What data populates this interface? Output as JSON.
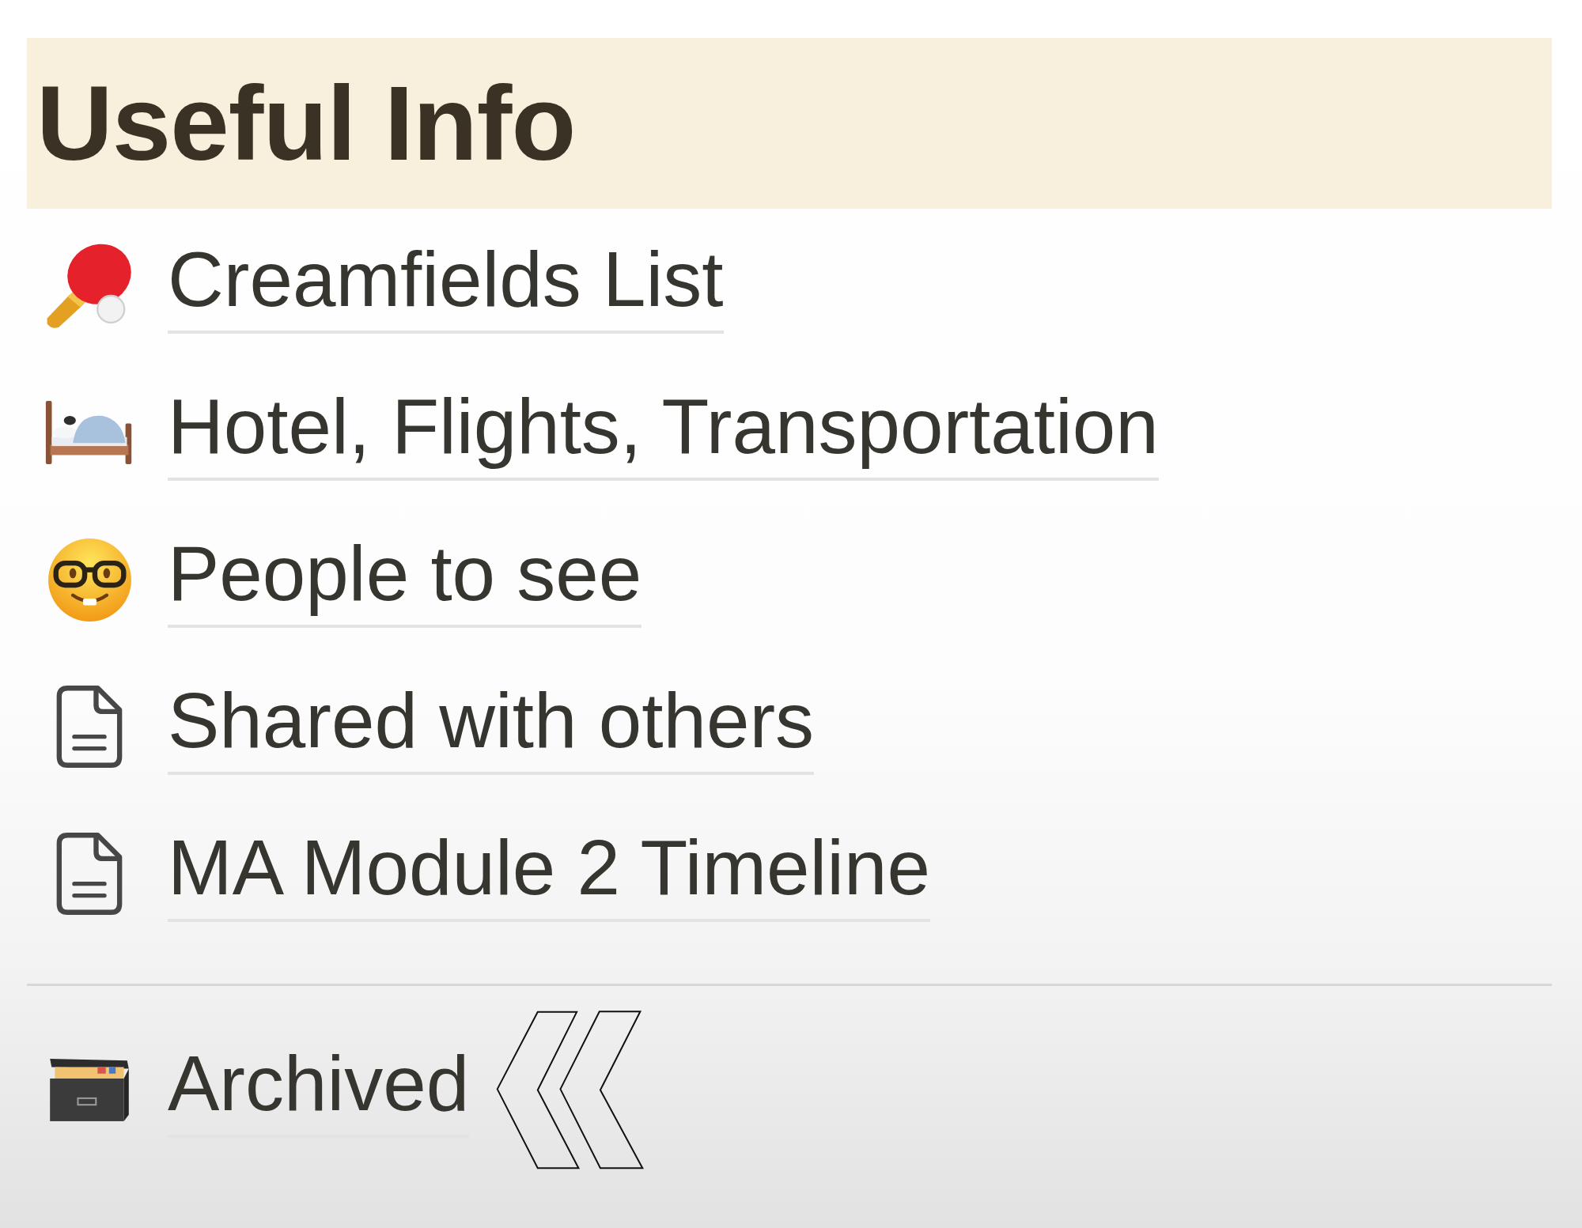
{
  "heading": {
    "title": "Useful Info"
  },
  "pages": [
    {
      "title": "Creamfields List"
    },
    {
      "title": "Hotel, Flights, Transportation"
    },
    {
      "title": "People to see"
    },
    {
      "title": "Shared with others"
    },
    {
      "title": "MA Module 2 Timeline"
    }
  ],
  "archive": {
    "title": "Archived"
  }
}
